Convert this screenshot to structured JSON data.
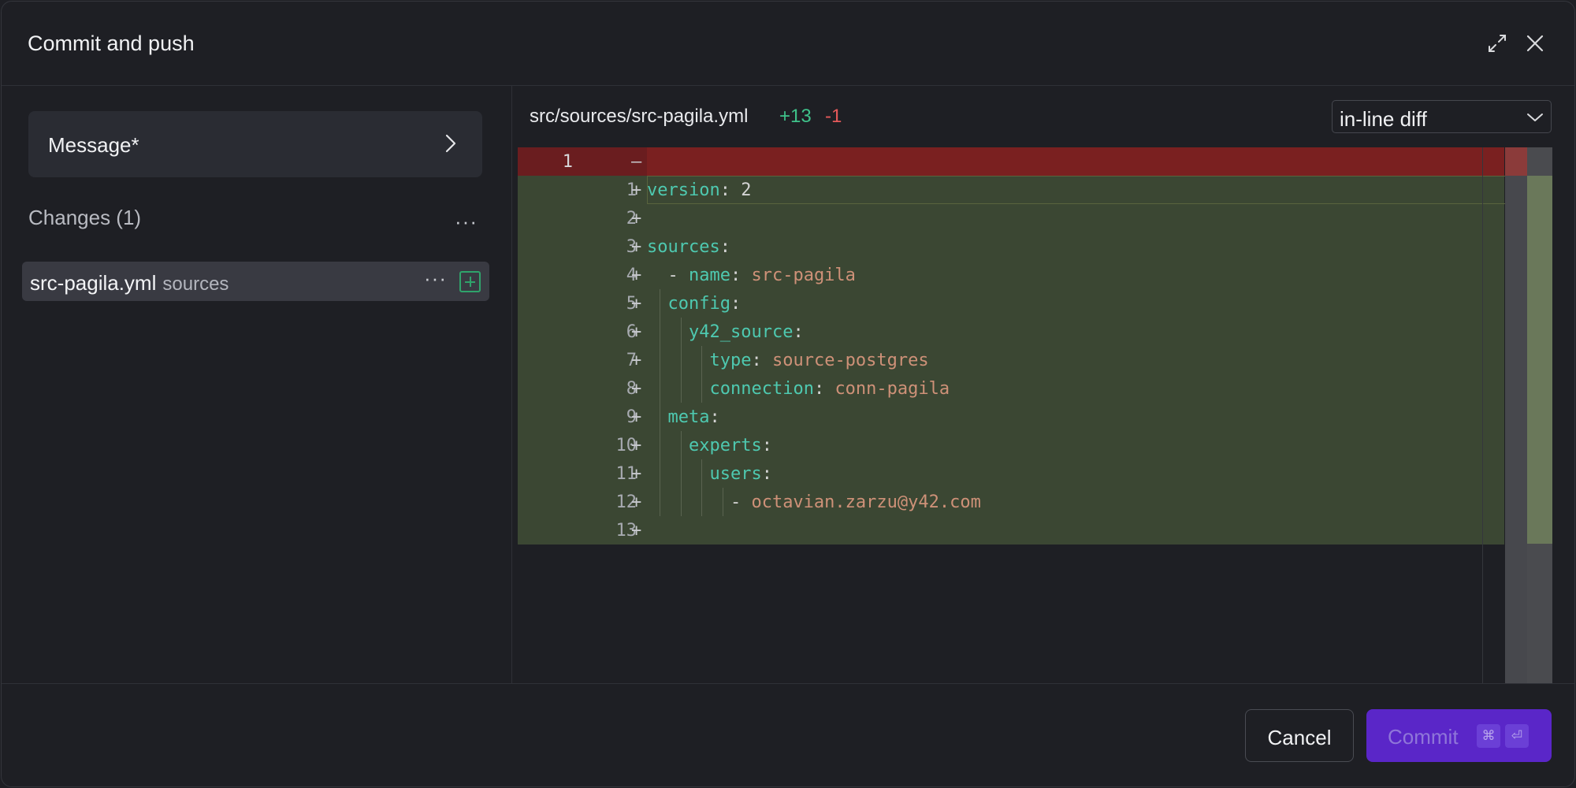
{
  "dialog": {
    "title": "Commit and push",
    "expand_icon": "expand-icon",
    "close_icon": "close-icon"
  },
  "left": {
    "message_label": "Message*",
    "changes_title": "Changes (1)",
    "more_label": "···",
    "file": {
      "name": "src-pagila.yml",
      "dir": "sources",
      "more_label": "···"
    }
  },
  "diff": {
    "path": "src/sources/src-pagila.yml",
    "additions": "+13",
    "deletions": "-1",
    "mode": "in-line diff",
    "deleted_line": {
      "old_no": "1",
      "sign": "—"
    },
    "lines": [
      {
        "no": "1",
        "sign": "+",
        "indent": 0,
        "key": "version",
        "sep": ": ",
        "val": "2",
        "valtype": "plain"
      },
      {
        "no": "2",
        "sign": "+",
        "indent": 0,
        "key": "",
        "sep": "",
        "val": "",
        "valtype": "plain"
      },
      {
        "no": "3",
        "sign": "+",
        "indent": 0,
        "key": "sources",
        "sep": ":",
        "val": "",
        "valtype": "plain"
      },
      {
        "no": "4",
        "sign": "+",
        "indent": 0,
        "prefix": "  - ",
        "key": "name",
        "sep": ": ",
        "val": "src-pagila",
        "valtype": "str"
      },
      {
        "no": "5",
        "sign": "+",
        "indent": 1,
        "key": "config",
        "sep": ":",
        "val": "",
        "valtype": "plain"
      },
      {
        "no": "6",
        "sign": "+",
        "indent": 2,
        "key": "y42_source",
        "sep": ":",
        "val": "",
        "valtype": "plain"
      },
      {
        "no": "7",
        "sign": "+",
        "indent": 3,
        "key": "type",
        "sep": ": ",
        "val": "source-postgres",
        "valtype": "str"
      },
      {
        "no": "8",
        "sign": "+",
        "indent": 3,
        "key": "connection",
        "sep": ": ",
        "val": "conn-pagila",
        "valtype": "str"
      },
      {
        "no": "9",
        "sign": "+",
        "indent": 1,
        "key": "meta",
        "sep": ":",
        "val": "",
        "valtype": "plain"
      },
      {
        "no": "10",
        "sign": "+",
        "indent": 2,
        "key": "experts",
        "sep": ":",
        "val": "",
        "valtype": "plain"
      },
      {
        "no": "11",
        "sign": "+",
        "indent": 3,
        "key": "users",
        "sep": ":",
        "val": "",
        "valtype": "plain"
      },
      {
        "no": "12",
        "sign": "+",
        "indent": 4,
        "prefix": "- ",
        "key": "",
        "sep": "",
        "val": "octavian.zarzu@y42.com",
        "valtype": "str"
      },
      {
        "no": "13",
        "sign": "+",
        "indent": 0,
        "key": "",
        "sep": "",
        "val": "",
        "valtype": "plain"
      }
    ]
  },
  "footer": {
    "cancel_label": "Cancel",
    "commit_label": "Commit",
    "shortcut_cmd": "⌘",
    "shortcut_enter": "⏎"
  },
  "colors": {
    "accent": "#5a26c8",
    "added_bg": "#3b4733",
    "deleted_bg": "#7a2020",
    "add_count": "#3fc28a",
    "del_count": "#e5595a"
  }
}
